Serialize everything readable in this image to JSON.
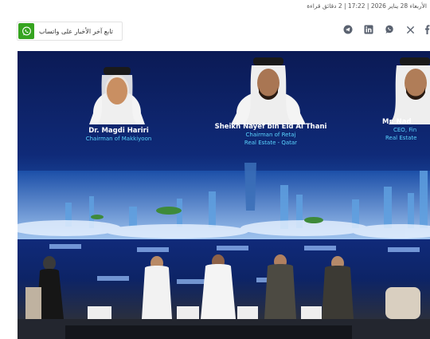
{
  "article_meta": "الأربعاء 28 يناير 2026 | 17:22 | 2 دقائق قراءة",
  "share": {
    "icons": [
      "telegram-icon",
      "linkedin-icon",
      "whatsapp-icon",
      "x-icon",
      "facebook-icon"
    ]
  },
  "whatsapp_follow": {
    "label": "تابع آخر الأخبار على واتساب",
    "icon": "whatsapp-icon",
    "accent": "#36a420"
  },
  "photo": {
    "speakers": [
      {
        "name": "Dr. Magdi Hariri",
        "role_line1": "Chairman of Makkiyoon",
        "role_line2": ""
      },
      {
        "name": "Sheikh Nayef bin Eid Al Thani",
        "role_line1": "Chairman of Retaj",
        "role_line2": "Real Estate - Qatar"
      },
      {
        "name": "Mr. Nad",
        "role_line1": "CEO, Fin",
        "role_line2": "Real Estate"
      }
    ]
  }
}
